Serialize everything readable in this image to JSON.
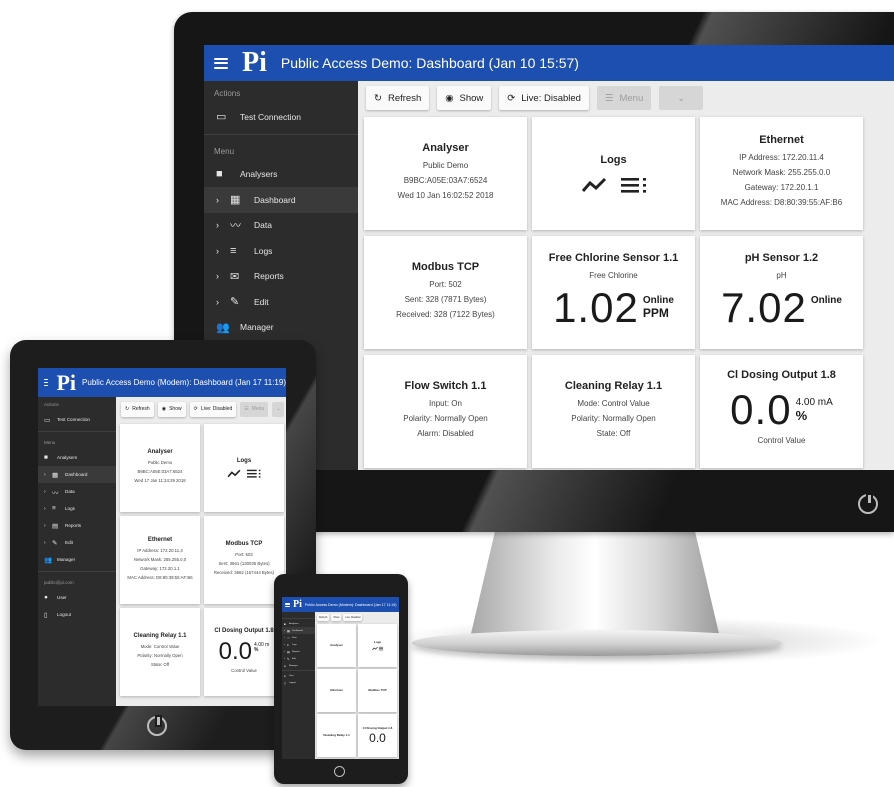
{
  "colors": {
    "header": "#1c4fb0",
    "sidebar": "#2c2c2c",
    "content_bg": "#ececec",
    "card_bg": "#ffffff"
  },
  "monitor": {
    "title": "Public Access Demo: Dashboard (Jan 10 15:57)",
    "logo": "Pi",
    "sidebar": {
      "actions_label": "Actions",
      "test_connection": "Test Connection",
      "menu_label": "Menu",
      "items": [
        "Analysers",
        "Dashboard",
        "Data",
        "Logs",
        "Reports",
        "Edit",
        "Manager"
      ]
    },
    "toolbar": {
      "refresh": "Refresh",
      "show": "Show",
      "live": "Live: Disabled",
      "menu": "Menu"
    },
    "cards": {
      "analyser": {
        "title": "Analyser",
        "lines": [
          "Public Demo",
          "B9BC:A05E:03A7:6524",
          "Wed 10 Jan 16:02:52 2018"
        ]
      },
      "logs": {
        "title": "Logs"
      },
      "ethernet": {
        "title": "Ethernet",
        "lines": [
          "IP Address: 172.20.11.4",
          "Network Mask: 255.255.0.0",
          "Gateway: 172.20.1.1",
          "MAC Address: D8:80:39:55:AF:B6"
        ]
      },
      "modbus": {
        "title": "Modbus TCP",
        "lines": [
          "Port: 502",
          "Sent: 328 (7871 Bytes)",
          "Received: 328 (7122 Bytes)"
        ]
      },
      "chlorine": {
        "title": "Free Chlorine Sensor 1.1",
        "sub": "Free Chlorine",
        "value": "1.02",
        "status": "Online",
        "unit": "PPM"
      },
      "ph": {
        "title": "pH Sensor 1.2",
        "sub": "pH",
        "value": "7.02",
        "status": "Online"
      },
      "flow": {
        "title": "Flow Switch 1.1",
        "lines": [
          "Input: On",
          "Polarity: Normally Open",
          "Alarm: Disabled"
        ]
      },
      "relay": {
        "title": "Cleaning Relay 1.1",
        "lines": [
          "Mode: Control Value",
          "Polarity: Normally Open",
          "State: Off"
        ]
      },
      "dosing": {
        "title": "Cl Dosing Output 1.8",
        "value": "0.0",
        "unit_top": "4.00 mA",
        "unit_bottom": "%",
        "caption": "Control Value"
      }
    }
  },
  "tablet": {
    "title": "Public Access Demo (Modem): Dashboard (Jan 17 11:19)",
    "logo": "Pi",
    "sidebar": {
      "actions_label": "Actions",
      "test_connection": "Test Connection",
      "menu_label": "Menu",
      "items": [
        "Analysers",
        "Dashboard",
        "Data",
        "Logs",
        "Reports",
        "Edit",
        "Manager"
      ],
      "user_label": "public@pi.com",
      "user": "User",
      "logout": "Logout"
    },
    "toolbar": {
      "refresh": "Refresh",
      "show": "Show",
      "live": "Live: Disabled",
      "menu": "Menu"
    },
    "cards": {
      "analyser": {
        "title": "Analyser",
        "lines": [
          "Public Demo",
          "B9BC:A05E:03A7:6524",
          "Wed 17 Jan 11:24:29 2018"
        ]
      },
      "logs": {
        "title": "Logs"
      },
      "ethernet": {
        "title": "Ethernet",
        "lines": [
          "IP Address: 172.20.11.4",
          "Network Mask: 255.255.0.0",
          "Gateway: 172.20.1.1",
          "MAC Address: D8:80:39:55:AF:B6"
        ]
      },
      "modbus": {
        "title": "Modbus TCP",
        "lines": [
          "Port: 502",
          "Sent: 3661 (130035 Bytes)",
          "Received: 3662 (157444 Bytes)"
        ]
      },
      "relay": {
        "title": "Cleaning Relay 1.1",
        "lines": [
          "Mode: Control Value",
          "Polarity: Normally Open",
          "State: Off"
        ]
      },
      "dosing": {
        "title": "Cl Dosing Output 1.8",
        "value": "0.0",
        "unit_top": "4.00 m",
        "unit_bottom": "%",
        "caption": "Control Value"
      }
    }
  },
  "phone": {
    "title": "Public Access Demo (Modem): Dashboard (Jan 17 11:19)",
    "logo": "Pi",
    "sidebar": {
      "items": [
        "Analysers",
        "Dashboard",
        "Data",
        "Logs",
        "Reports",
        "Edit",
        "Manager"
      ],
      "user": "User",
      "logout": "Logout"
    },
    "toolbar": {
      "refresh": "Refresh",
      "show": "Show",
      "live": "Live: Disabled"
    },
    "cards": {
      "analyser": {
        "title": "Analyser"
      },
      "logs": {
        "title": "Logs"
      },
      "ethernet": {
        "title": "Ethernet"
      },
      "modbus": {
        "title": "Modbus TCP"
      },
      "relay": {
        "title": "Cleaning Relay 1.1"
      },
      "dosing": {
        "title": "Cl Dosing Output 1.8",
        "value": "0.0"
      }
    }
  }
}
